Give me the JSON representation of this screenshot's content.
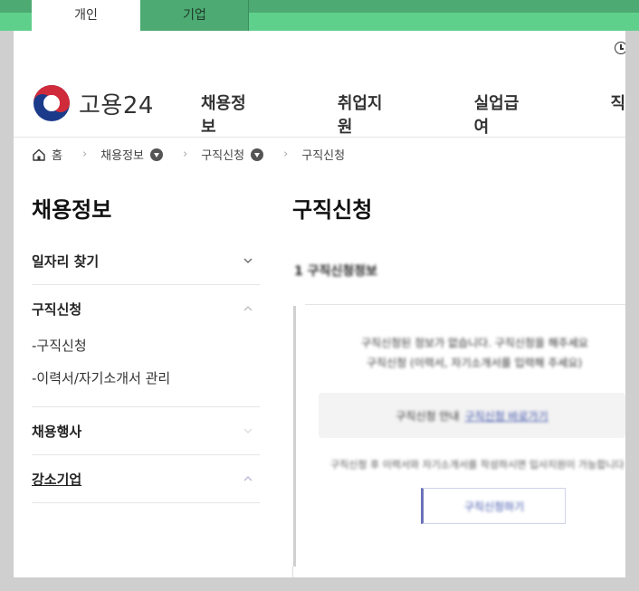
{
  "top_tabs": [
    {
      "label": "개인",
      "active": true
    },
    {
      "label": "기업",
      "active": false
    }
  ],
  "header": {
    "logo_text": "고용24",
    "nav": [
      "채용정보",
      "취업지원",
      "실업급여",
      "직"
    ]
  },
  "breadcrumb": [
    "홈",
    "채용정보",
    "구직신청",
    "구직신청"
  ],
  "sidebar": {
    "title": "채용정보",
    "items": [
      {
        "label": "일자리 찾기",
        "expanded": false
      },
      {
        "label": "구직신청",
        "expanded": true,
        "children": [
          "-구직신청",
          "-이력서/자기소개서 관리"
        ]
      },
      {
        "label": "채용행사",
        "expanded": false
      },
      {
        "label": "강소기업",
        "expanded": false
      }
    ]
  },
  "content": {
    "title": "구직신청",
    "section_title": "1 구직신청정보",
    "message_line1": "구직신청된 정보가 없습니다. 구직신청을 해주세요",
    "message_line2": "구직신청 (이력서, 자기소개서를 입력해 주세요)",
    "info_text": "구직신청 안내",
    "info_link": "구직신청 바로가기",
    "note": "구직신청 후 이력서와 자기소개서를 작성하시면 입사지원이 가능합니다 (구르시",
    "button_label": "구직신청하기"
  },
  "colors": {
    "top_green": "#5fd08c",
    "top_green_dark": "#4caa72",
    "link_blue": "#3a4fa8"
  }
}
